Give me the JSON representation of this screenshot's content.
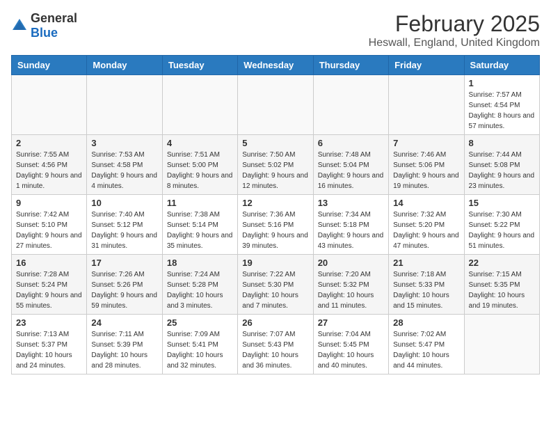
{
  "logo": {
    "general": "General",
    "blue": "Blue"
  },
  "title": "February 2025",
  "subtitle": "Heswall, England, United Kingdom",
  "days_of_week": [
    "Sunday",
    "Monday",
    "Tuesday",
    "Wednesday",
    "Thursday",
    "Friday",
    "Saturday"
  ],
  "weeks": [
    [
      {
        "day": "",
        "info": ""
      },
      {
        "day": "",
        "info": ""
      },
      {
        "day": "",
        "info": ""
      },
      {
        "day": "",
        "info": ""
      },
      {
        "day": "",
        "info": ""
      },
      {
        "day": "",
        "info": ""
      },
      {
        "day": "1",
        "info": "Sunrise: 7:57 AM\nSunset: 4:54 PM\nDaylight: 8 hours and 57 minutes."
      }
    ],
    [
      {
        "day": "2",
        "info": "Sunrise: 7:55 AM\nSunset: 4:56 PM\nDaylight: 9 hours and 1 minute."
      },
      {
        "day": "3",
        "info": "Sunrise: 7:53 AM\nSunset: 4:58 PM\nDaylight: 9 hours and 4 minutes."
      },
      {
        "day": "4",
        "info": "Sunrise: 7:51 AM\nSunset: 5:00 PM\nDaylight: 9 hours and 8 minutes."
      },
      {
        "day": "5",
        "info": "Sunrise: 7:50 AM\nSunset: 5:02 PM\nDaylight: 9 hours and 12 minutes."
      },
      {
        "day": "6",
        "info": "Sunrise: 7:48 AM\nSunset: 5:04 PM\nDaylight: 9 hours and 16 minutes."
      },
      {
        "day": "7",
        "info": "Sunrise: 7:46 AM\nSunset: 5:06 PM\nDaylight: 9 hours and 19 minutes."
      },
      {
        "day": "8",
        "info": "Sunrise: 7:44 AM\nSunset: 5:08 PM\nDaylight: 9 hours and 23 minutes."
      }
    ],
    [
      {
        "day": "9",
        "info": "Sunrise: 7:42 AM\nSunset: 5:10 PM\nDaylight: 9 hours and 27 minutes."
      },
      {
        "day": "10",
        "info": "Sunrise: 7:40 AM\nSunset: 5:12 PM\nDaylight: 9 hours and 31 minutes."
      },
      {
        "day": "11",
        "info": "Sunrise: 7:38 AM\nSunset: 5:14 PM\nDaylight: 9 hours and 35 minutes."
      },
      {
        "day": "12",
        "info": "Sunrise: 7:36 AM\nSunset: 5:16 PM\nDaylight: 9 hours and 39 minutes."
      },
      {
        "day": "13",
        "info": "Sunrise: 7:34 AM\nSunset: 5:18 PM\nDaylight: 9 hours and 43 minutes."
      },
      {
        "day": "14",
        "info": "Sunrise: 7:32 AM\nSunset: 5:20 PM\nDaylight: 9 hours and 47 minutes."
      },
      {
        "day": "15",
        "info": "Sunrise: 7:30 AM\nSunset: 5:22 PM\nDaylight: 9 hours and 51 minutes."
      }
    ],
    [
      {
        "day": "16",
        "info": "Sunrise: 7:28 AM\nSunset: 5:24 PM\nDaylight: 9 hours and 55 minutes."
      },
      {
        "day": "17",
        "info": "Sunrise: 7:26 AM\nSunset: 5:26 PM\nDaylight: 9 hours and 59 minutes."
      },
      {
        "day": "18",
        "info": "Sunrise: 7:24 AM\nSunset: 5:28 PM\nDaylight: 10 hours and 3 minutes."
      },
      {
        "day": "19",
        "info": "Sunrise: 7:22 AM\nSunset: 5:30 PM\nDaylight: 10 hours and 7 minutes."
      },
      {
        "day": "20",
        "info": "Sunrise: 7:20 AM\nSunset: 5:32 PM\nDaylight: 10 hours and 11 minutes."
      },
      {
        "day": "21",
        "info": "Sunrise: 7:18 AM\nSunset: 5:33 PM\nDaylight: 10 hours and 15 minutes."
      },
      {
        "day": "22",
        "info": "Sunrise: 7:15 AM\nSunset: 5:35 PM\nDaylight: 10 hours and 19 minutes."
      }
    ],
    [
      {
        "day": "23",
        "info": "Sunrise: 7:13 AM\nSunset: 5:37 PM\nDaylight: 10 hours and 24 minutes."
      },
      {
        "day": "24",
        "info": "Sunrise: 7:11 AM\nSunset: 5:39 PM\nDaylight: 10 hours and 28 minutes."
      },
      {
        "day": "25",
        "info": "Sunrise: 7:09 AM\nSunset: 5:41 PM\nDaylight: 10 hours and 32 minutes."
      },
      {
        "day": "26",
        "info": "Sunrise: 7:07 AM\nSunset: 5:43 PM\nDaylight: 10 hours and 36 minutes."
      },
      {
        "day": "27",
        "info": "Sunrise: 7:04 AM\nSunset: 5:45 PM\nDaylight: 10 hours and 40 minutes."
      },
      {
        "day": "28",
        "info": "Sunrise: 7:02 AM\nSunset: 5:47 PM\nDaylight: 10 hours and 44 minutes."
      },
      {
        "day": "",
        "info": ""
      }
    ]
  ]
}
